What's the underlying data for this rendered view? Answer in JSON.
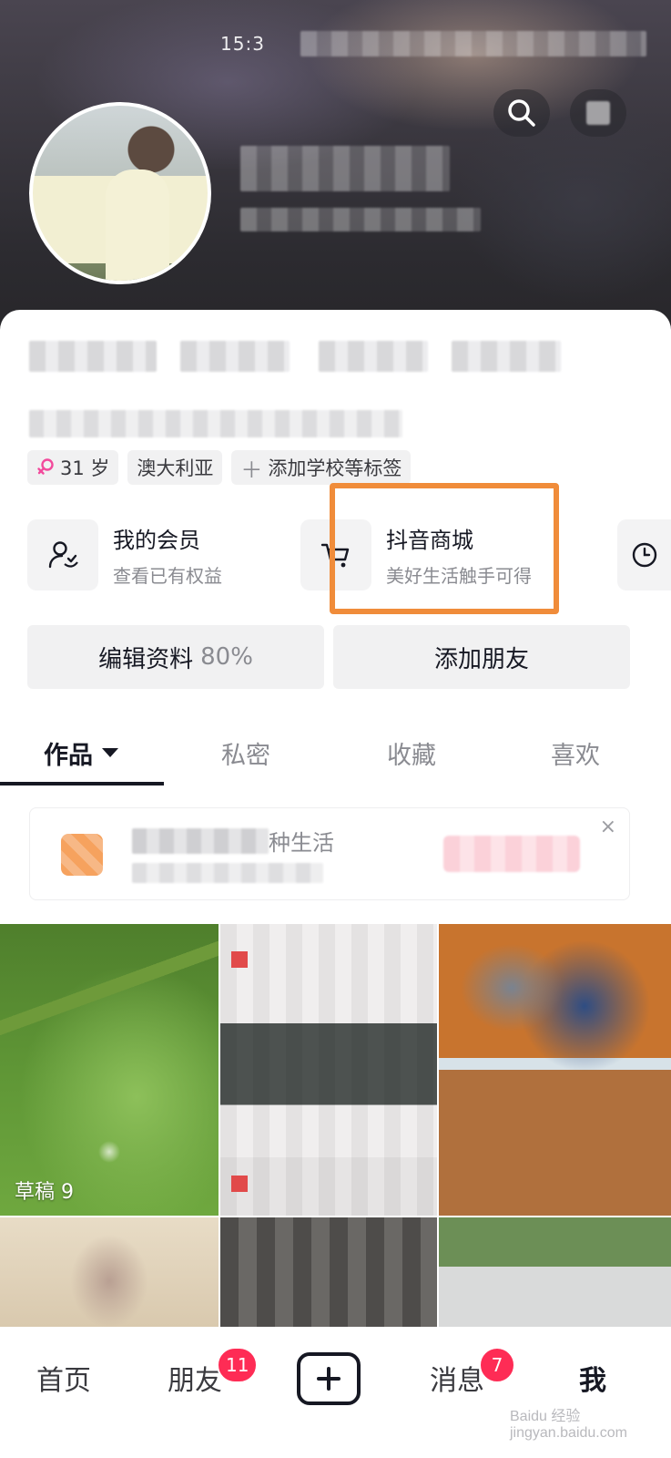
{
  "status_bar": {
    "time": "15:3"
  },
  "header": {
    "search_icon": "search-icon",
    "more_icon": "more-icon"
  },
  "tags": {
    "age": "31 岁",
    "region": "澳大利亚",
    "add_tag": "添加学校等标签"
  },
  "cards": [
    {
      "title": "我的会员",
      "subtitle": "查看已有权益",
      "icon": "member-icon"
    },
    {
      "title": "抖音商城",
      "subtitle": "美好生活触手可得",
      "icon": "cart-icon"
    }
  ],
  "actions": {
    "edit_profile": "编辑资料",
    "edit_percent": "80%",
    "add_friend": "添加朋友"
  },
  "tabs": [
    {
      "label": "作品",
      "active": true
    },
    {
      "label": "私密",
      "active": false
    },
    {
      "label": "收藏",
      "active": false
    },
    {
      "label": "喜欢",
      "active": false
    }
  ],
  "banner": {
    "title_suffix": "种生活",
    "close": "×"
  },
  "grid": {
    "draft_label": "草稿 9"
  },
  "bottom_nav": {
    "home": "首页",
    "friends": "朋友",
    "friends_badge": "11",
    "messages": "消息",
    "messages_badge": "7",
    "me": "我"
  },
  "watermark": "Baidu 经验 jingyan.baidu.com",
  "colors": {
    "accent": "#fe2c55",
    "highlight": "#f08c3a"
  }
}
